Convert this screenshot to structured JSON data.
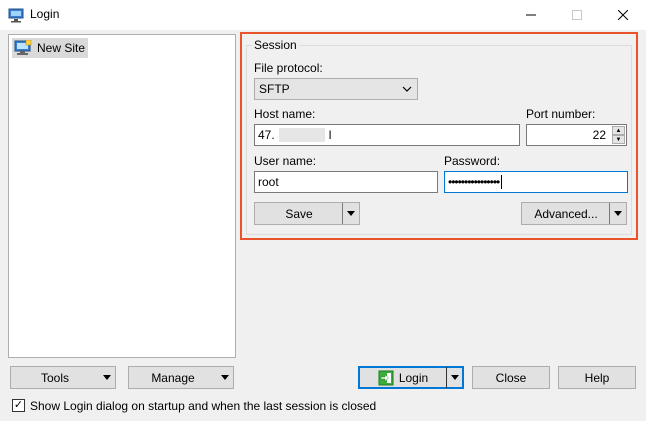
{
  "window": {
    "title": "Login"
  },
  "sites": [
    {
      "label": "New Site"
    }
  ],
  "session": {
    "group_title": "Session",
    "file_protocol_label": "File protocol:",
    "file_protocol_value": "SFTP",
    "host_label": "Host name:",
    "host_value_prefix": "47.",
    "host_value_suffix": "l",
    "port_label": "Port number:",
    "port_value": "22",
    "user_label": "User name:",
    "user_value": "root",
    "password_label": "Password:",
    "password_value": "••••••••••••••••",
    "save_label": "Save",
    "advanced_label": "Advanced..."
  },
  "bottom": {
    "tools_label": "Tools",
    "manage_label": "Manage",
    "login_label": "Login",
    "close_label": "Close",
    "help_label": "Help",
    "show_dialog_label": "Show Login dialog on startup and when the last session is closed"
  }
}
